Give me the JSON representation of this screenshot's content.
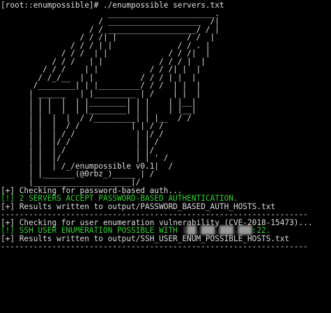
{
  "colors": {
    "background": "#000000",
    "text": "#dcdcdc",
    "success": "#2fd12f"
  },
  "prompt": {
    "text": "[root::enumpossible]# ./enumpossible servers.txt"
  },
  "banner": [
    "                       _______________________.",
    "                     / ____________________  /|",
    "                   / / ___________________/ / |",
    "                 / / /| |               / /  |",
    "               / / / | |              / / . |",
    "             / / /  | |             / / /|  |",
    "           / / /   | |            / / / |  |",
    "         / / /    | |           / / /| |  |",
    "        / /_/__  | |          / / / | |  |",
    "       /________| | |_________/ / /  | |  |",
    "      | ______   | |_________ | /    | |  |",
    "      | | |  |  | |________| | |    | |__|",
    "      | | |  |  | |________| | |    | |__|",
    "      | |  |  |  / /_________| | |__  / /",
    "      | |  |  / /           | | / /",
    "      | |  | / /             | |/ /",
    "      | |  |/ /              | | /",
    "      | |  | /               | |/",
    "      | |  |/                | | ' /",
    "      | |  | /_/enumpossible v0.1|  /",
    "      | |_______(@0rbz_)_____ | /",
    "      |_____________________|/"
  ],
  "output": {
    "check_password": "[+] Checking for password-based auth...",
    "password_result": "[!] 2 SERVERS ACCEPT PASSWORD-BASED AUTHENTICATION.",
    "password_written": "[+] Results written to output/PASSWORD_BASED_AUTH_HOSTS.txt",
    "separator": "------------------------------------------------------------------",
    "check_enum": "[+] Checking for user enumeration vulnerability (CVE-2018-15473)...",
    "enum_result_prefix": "[!] SSH USER ENUMERATION POSSIBLE WITH ",
    "enum_result_redacted": "1██.███.███.███",
    "enum_result_suffix": ":22.",
    "enum_written": "[+] Results written to output/SSH_USER_ENUM_POSSIBLE_HOSTS.txt"
  }
}
